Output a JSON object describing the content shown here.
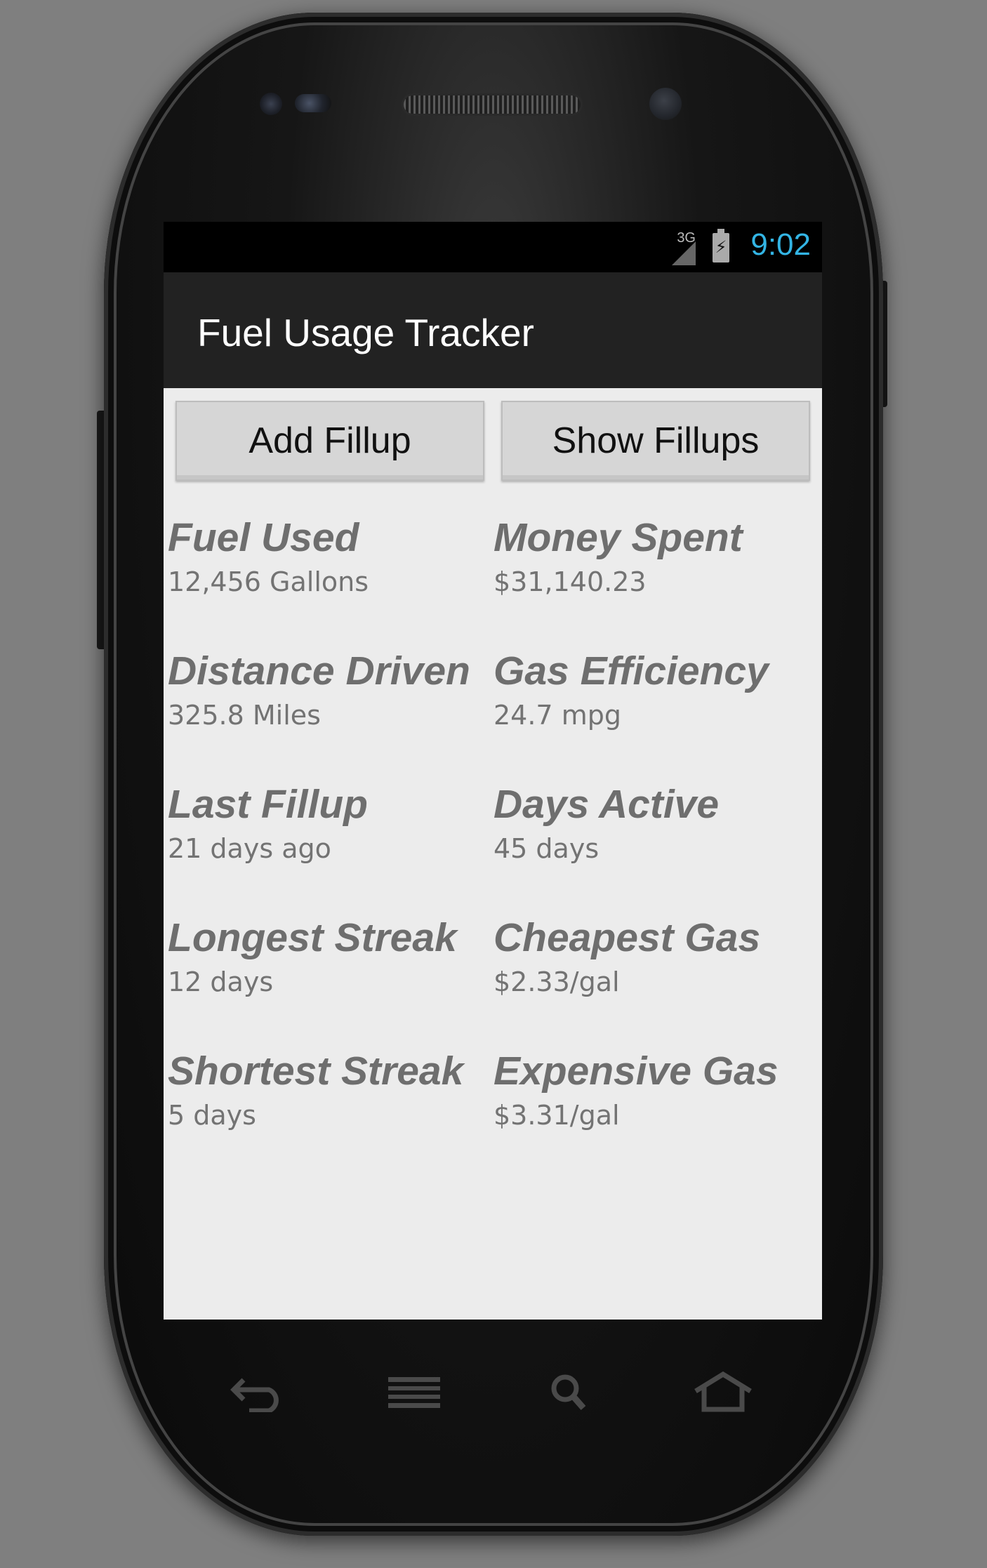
{
  "status_bar": {
    "network": "3G",
    "battery_icon": "battery-charging-icon",
    "signal_icon": "signal-icon",
    "time": "9:02",
    "clock_color": "#33b5e5"
  },
  "action_bar": {
    "title": "Fuel Usage Tracker"
  },
  "buttons": {
    "add_fillup": "Add Fillup",
    "show_fillups": "Show Fillups"
  },
  "stats": [
    {
      "label": "Fuel Used",
      "value": "12,456 Gallons"
    },
    {
      "label": "Money Spent",
      "value": "$31,140.23"
    },
    {
      "label": "Distance Driven",
      "value": "325.8 Miles"
    },
    {
      "label": "Gas Efficiency",
      "value": "24.7 mpg"
    },
    {
      "label": "Last Fillup",
      "value": "21 days ago"
    },
    {
      "label": "Days Active",
      "value": "45 days"
    },
    {
      "label": "Longest Streak",
      "value": "12 days"
    },
    {
      "label": "Cheapest Gas",
      "value": "$2.33/gal"
    },
    {
      "label": "Shortest Streak",
      "value": "5 days"
    },
    {
      "label": "Expensive Gas",
      "value": "$3.31/gal"
    }
  ],
  "nav_icons": [
    "back-icon",
    "menu-icon",
    "search-icon",
    "home-icon"
  ]
}
